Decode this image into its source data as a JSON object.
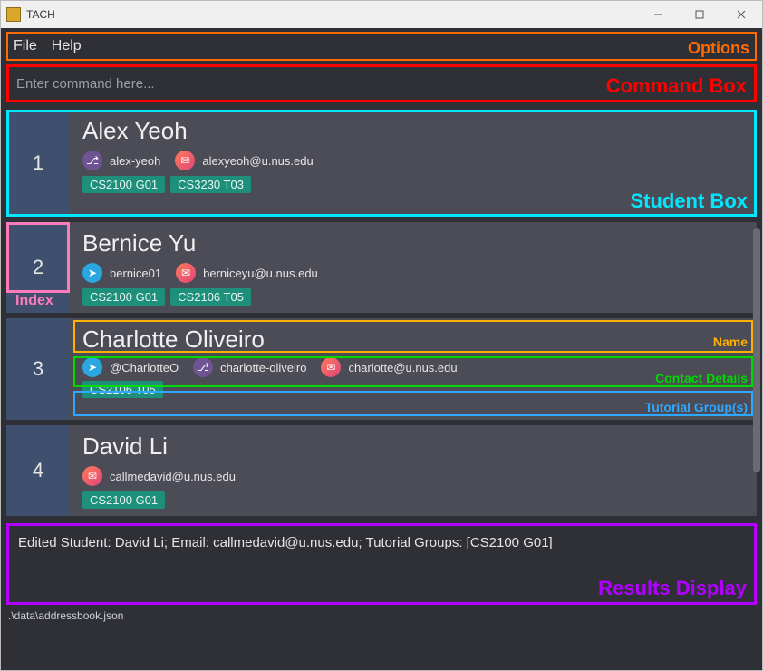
{
  "window": {
    "title": "TACH"
  },
  "menubar": {
    "file": "File",
    "help": "Help",
    "annotation": "Options"
  },
  "command": {
    "placeholder": "Enter command here...",
    "value": "",
    "annotation": "Command Box"
  },
  "annotations": {
    "student_box": "Student Box",
    "index": "Index",
    "name": "Name",
    "contact_details": "Contact Details",
    "tutorial_groups": "Tutorial Group(s)",
    "results_display": "Results Display"
  },
  "students": [
    {
      "index": "1",
      "name": "Alex Yeoh",
      "contacts": [
        {
          "type": "github",
          "icon": "github-icon",
          "text": "alex-yeoh"
        },
        {
          "type": "email",
          "icon": "email-icon",
          "text": "alexyeoh@u.nus.edu"
        }
      ],
      "groups": [
        "CS2100 G01",
        "CS3230 T03"
      ]
    },
    {
      "index": "2",
      "name": "Bernice Yu",
      "contacts": [
        {
          "type": "telegram",
          "icon": "telegram-icon",
          "text": "bernice01"
        },
        {
          "type": "email",
          "icon": "email-icon",
          "text": "berniceyu@u.nus.edu"
        }
      ],
      "groups": [
        "CS2100 G01",
        "CS2106 T05"
      ]
    },
    {
      "index": "3",
      "name": "Charlotte Oliveiro",
      "contacts": [
        {
          "type": "telegram",
          "icon": "telegram-icon",
          "text": "@CharlotteO"
        },
        {
          "type": "github",
          "icon": "github-icon",
          "text": "charlotte-oliveiro"
        },
        {
          "type": "email",
          "icon": "email-icon",
          "text": "charlotte@u.nus.edu"
        }
      ],
      "groups": [
        "CS2106 T05"
      ]
    },
    {
      "index": "4",
      "name": "David Li",
      "contacts": [
        {
          "type": "email",
          "icon": "email-icon",
          "text": "callmedavid@u.nus.edu"
        }
      ],
      "groups": [
        "CS2100 G01"
      ]
    }
  ],
  "results": {
    "text": "Edited Student: David Li; Email: callmedavid@u.nus.edu; Tutorial Groups: [CS2100 G01]"
  },
  "statusbar": {
    "path": ".\\data\\addressbook.json"
  },
  "icon_glyph": {
    "github": "⎇",
    "email": "✉",
    "telegram": "➤"
  }
}
